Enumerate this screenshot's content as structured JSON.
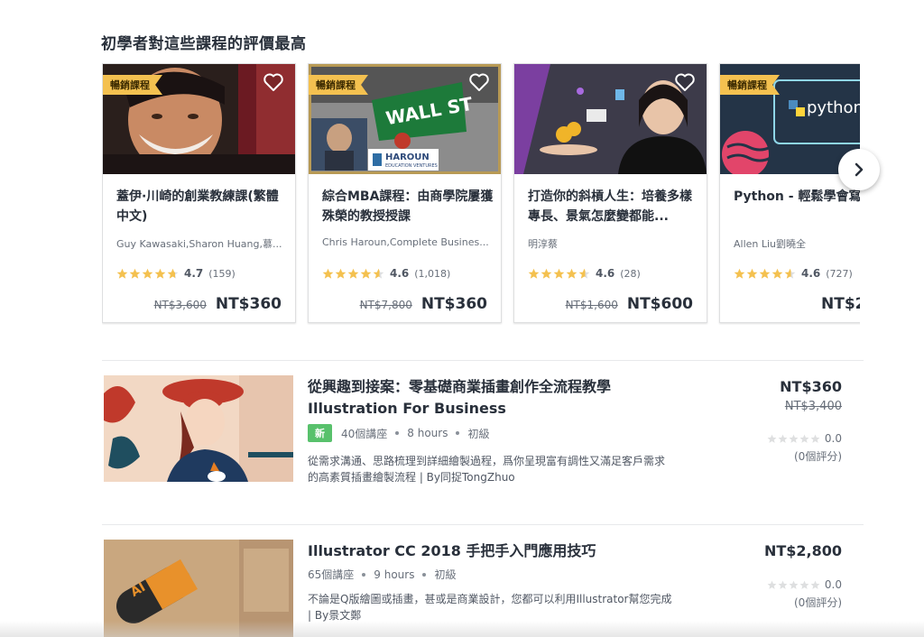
{
  "section": {
    "title": "初學者對這些課程的評價最高"
  },
  "cards": [
    {
      "badge": "暢銷課程",
      "title": "蓋伊·川崎的創業教練課(繁體中文)",
      "author": "Guy Kawasaki,Sharon Huang,慕...",
      "rating": "4.7",
      "rating_value": 4.7,
      "reviews": "(159)",
      "old_price": "NT$3,600",
      "price": "NT$360"
    },
    {
      "badge": "暢銷課程",
      "title": "綜合MBA課程：由商學院屢獲殊榮的教授授課",
      "author": "Chris Haroun,Complete Busines...",
      "rating": "4.6",
      "rating_value": 4.6,
      "reviews": "(1,018)",
      "old_price": "NT$7,800",
      "price": "NT$360",
      "thumb_text": {
        "sign": "WALL ST",
        "logo": "HAROUN",
        "logo_sub": "EDUCATION VENTURES"
      }
    },
    {
      "badge": "",
      "title": "打造你的斜槓人生：培養多樣專長、景氣怎麼變都能...",
      "author": "明淳蔡",
      "rating": "4.6",
      "rating_value": 4.6,
      "reviews": "(28)",
      "old_price": "NT$1,600",
      "price": "NT$600"
    },
    {
      "badge": "暢銷課程",
      "title": "Python - 輕鬆學會寫",
      "author": "Allen Liu劉曉全",
      "rating": "4.6",
      "rating_value": 4.6,
      "reviews": "(727)",
      "old_price": "",
      "price": "NT$2",
      "thumb_text": {
        "logo": "python"
      }
    }
  ],
  "courses": [
    {
      "title_line1": "從興趣到接案：零基礎商業插畫創作全流程教學",
      "title_line2": "Illustration For Business",
      "tag": "新",
      "lectures": "40個講座",
      "hours": "8 hours",
      "level": "初級",
      "desc_line1": "從需求溝通、思路梳理到詳細繪製過程，爲你呈現富有調性又滿足客戶需求",
      "desc_line2": "的高素質插畫繪製流程 | By同捉TongZhuo",
      "price": "NT$360",
      "old_price": "NT$3,400",
      "rating": "0.0",
      "rating_value": 0,
      "reviews": "(0個評分)"
    },
    {
      "title_line1": "Illustrator CC 2018 手把手入門應用技巧",
      "tag": "",
      "lectures": "65個講座",
      "hours": "9 hours",
      "level": "初級",
      "desc_line1": "不論是Q版繪圖或插畫，甚或是商業設計，您都可以利用Illustrator幫您完成",
      "desc_line2": "| By景文鄭",
      "price": "NT$2,800",
      "rating": "0.0",
      "rating_value": 0,
      "reviews": "(0個評分)",
      "thumb_text": {
        "pill": "AI"
      }
    }
  ],
  "colors": {
    "star": "#f4c150",
    "badge": "#f4c150",
    "new_tag": "#58c16c",
    "star_empty": "#dedfe0"
  },
  "icons": {
    "heart": "heart-outline-icon",
    "next": "chevron-right-icon",
    "star": "star-icon"
  }
}
